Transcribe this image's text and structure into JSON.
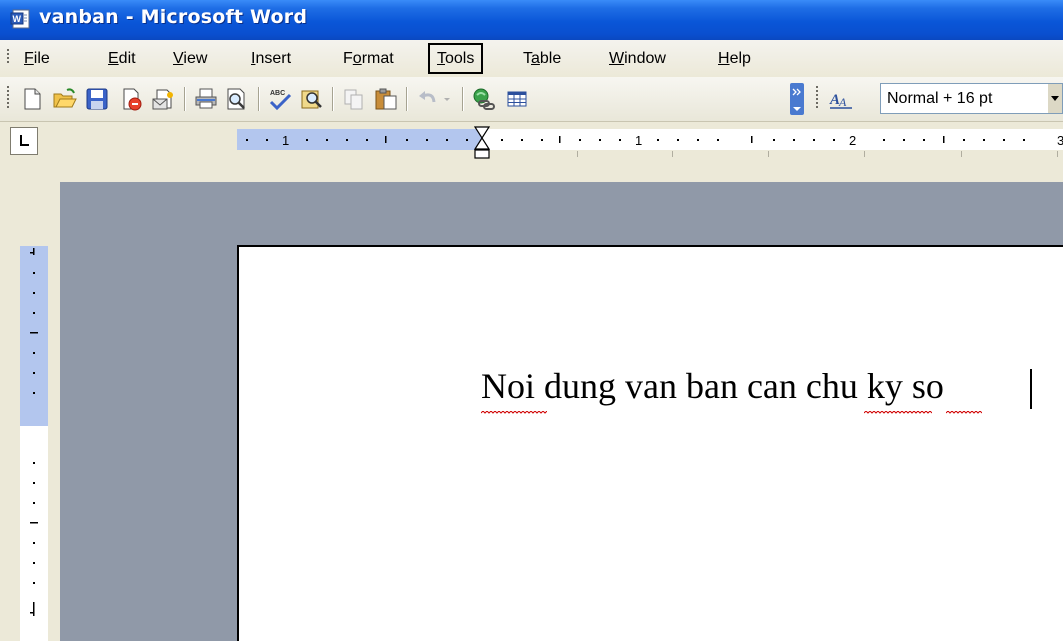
{
  "window": {
    "title": "vanban - Microsoft Word",
    "app_icon": "word-doc-icon"
  },
  "menu": {
    "items": [
      {
        "id": "file",
        "label": "File",
        "mnemonic": "F",
        "rest": "ile"
      },
      {
        "id": "edit",
        "label": "Edit",
        "mnemonic": "E",
        "rest": "dit"
      },
      {
        "id": "view",
        "label": "View",
        "mnemonic": "V",
        "rest": "iew"
      },
      {
        "id": "insert",
        "label": "Insert",
        "mnemonic": "I",
        "rest": "nsert"
      },
      {
        "id": "format",
        "label": "Format",
        "pre": "F",
        "mnemonic": "o",
        "rest": "rmat"
      },
      {
        "id": "tools",
        "label": "Tools",
        "mnemonic": "T",
        "rest": "ools",
        "highlighted": true
      },
      {
        "id": "table",
        "label": "Table",
        "pre": "T",
        "mnemonic": "a",
        "rest": "ble"
      },
      {
        "id": "window",
        "label": "Window",
        "mnemonic": "W",
        "rest": "indow"
      },
      {
        "id": "help",
        "label": "Help",
        "mnemonic": "H",
        "rest": "elp"
      }
    ]
  },
  "toolbar": {
    "icons": [
      "new-document-icon",
      "open-folder-icon",
      "save-icon",
      "permission-icon",
      "email-icon",
      "print-icon",
      "print-preview-icon",
      "spelling-grammar-icon",
      "research-icon",
      "copy-icon",
      "paste-icon",
      "undo-icon",
      "hyperlink-icon",
      "table-grid-icon",
      "toolbar-options-icon",
      "styles-formatting-icon"
    ],
    "style_value": "Normal + 16 pt"
  },
  "ruler": {
    "labels": [
      "1",
      "1",
      "2",
      "3"
    ]
  },
  "document": {
    "text": "Noi dung van ban can chu ky so"
  },
  "colors": {
    "titlebar": "#0a56d8",
    "chrome": "#ece9d8",
    "workspace": "#9099a8",
    "ruler_margin": "#b3c6ee",
    "spelling_squiggle": "#d00000"
  }
}
